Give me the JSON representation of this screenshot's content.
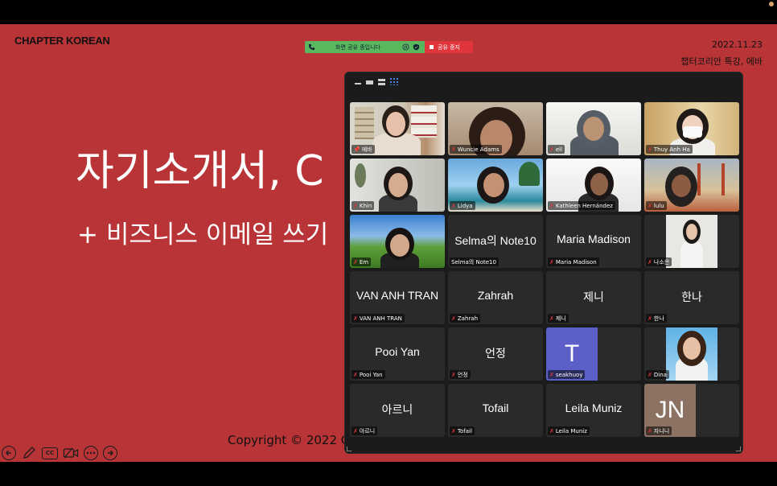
{
  "slide": {
    "brand": "CHAPTER KOREAN",
    "date": "2022.11.23",
    "subtitle_right": "챕터코리안 특강, 에바",
    "title": "자기소개서, C",
    "subtitle": "+ 비즈니스 이메일 쓰기",
    "copyright": "Copyright © 2022 C"
  },
  "share_bar": {
    "status_text": "화면 공유 중입니다",
    "stop_label": "공유 중지",
    "status_color": "#59b85d",
    "stop_color": "#e0353a"
  },
  "slide_controls": [
    "arrow-left-icon",
    "pen-icon",
    "cc-icon",
    "video-icon",
    "more-icon",
    "arrow-right-icon"
  ],
  "slide_controls_cc": "CC",
  "view_options": [
    "minimize-icon",
    "strip-view-icon",
    "speaker-view-icon",
    "gallery-view-icon"
  ],
  "participants": [
    {
      "name": "에바",
      "big": "",
      "kind": "video",
      "pinned": true,
      "active": true
    },
    {
      "name": "Wuncie Adams",
      "big": "",
      "kind": "video"
    },
    {
      "name": "ell",
      "big": "",
      "kind": "video"
    },
    {
      "name": "Thuy Anh Ha",
      "big": "",
      "kind": "video"
    },
    {
      "name": "Khin",
      "big": "",
      "kind": "video"
    },
    {
      "name": "Lidya",
      "big": "",
      "kind": "video"
    },
    {
      "name": "Kathleen Hernández",
      "big": "",
      "kind": "video"
    },
    {
      "name": "lulu",
      "big": "",
      "kind": "video"
    },
    {
      "name": "Em",
      "big": "",
      "kind": "video"
    },
    {
      "name": "Selma의 Note10",
      "big": "Selma의 Note10",
      "kind": "name"
    },
    {
      "name": "Maria Madison",
      "big": "Maria Madison",
      "kind": "name"
    },
    {
      "name": "나소은",
      "big": "",
      "kind": "photo"
    },
    {
      "name": "VAN ANH TRAN",
      "big": "VAN ANH TRAN",
      "kind": "name"
    },
    {
      "name": "Zahrah",
      "big": "Zahrah",
      "kind": "name"
    },
    {
      "name": "제니",
      "big": "제니",
      "kind": "name"
    },
    {
      "name": "한나",
      "big": "한나",
      "kind": "name"
    },
    {
      "name": "Pooi Yan",
      "big": "Pooi Yan",
      "kind": "name"
    },
    {
      "name": "언정",
      "big": "언정",
      "kind": "name"
    },
    {
      "name": "seakhuoy",
      "big": "T",
      "kind": "initial"
    },
    {
      "name": "Dina",
      "big": "",
      "kind": "photo"
    },
    {
      "name": "아르니",
      "big": "아르니",
      "kind": "name"
    },
    {
      "name": "Tofail",
      "big": "Tofail",
      "kind": "name"
    },
    {
      "name": "Leila Muniz",
      "big": "Leila Muniz",
      "kind": "name"
    },
    {
      "name": "자니니",
      "big": "JN",
      "kind": "initial"
    }
  ],
  "colors": {
    "slide_bg": "#b83436",
    "panel_bg": "#1b1b1b",
    "tile_bg": "#2a2a2a",
    "active_outline": "#3ea34a",
    "muted_mic": "#e0353a",
    "avatar_t": "#5b5fc7",
    "avatar_jn": "#8c7262"
  }
}
